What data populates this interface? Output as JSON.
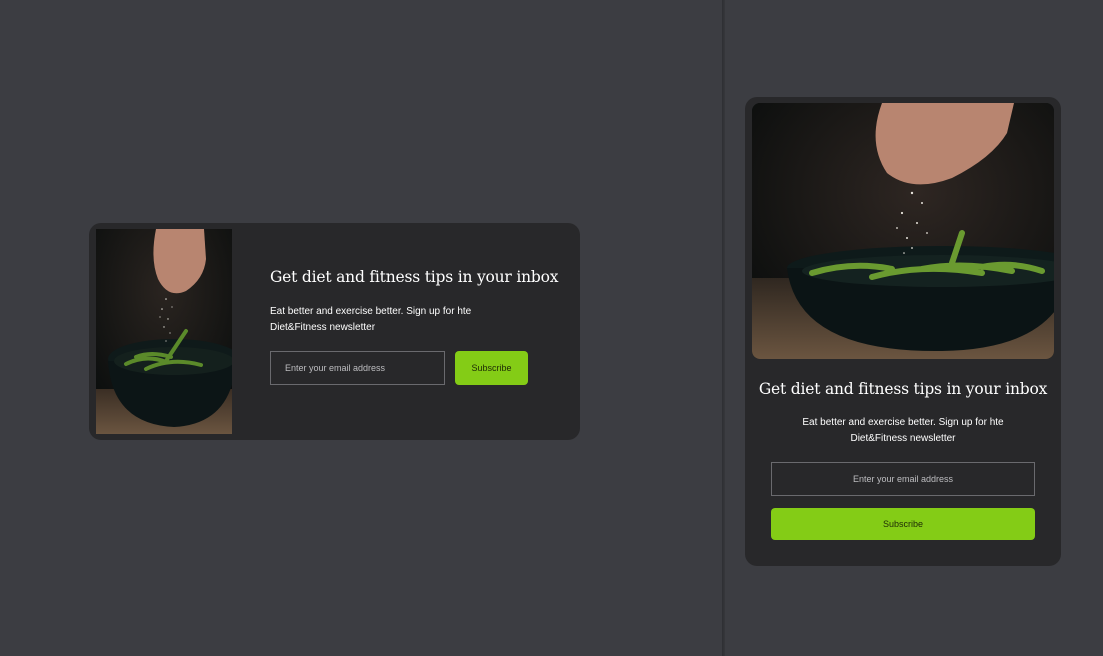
{
  "newsletter": {
    "title": "Get diet and fitness tips in your inbox",
    "description": "Eat better and exercise better. Sign up for hte Diet&Fitness newsletter",
    "email_placeholder": "Enter your email address",
    "subscribe_label": "Subscribe",
    "image": "hand-sprinkling-salt-on-edamame-bowl"
  },
  "colors": {
    "page_bg": "#3c3d42",
    "card_bg": "#28282a",
    "accent": "#84cc16",
    "text": "#ffffff"
  }
}
